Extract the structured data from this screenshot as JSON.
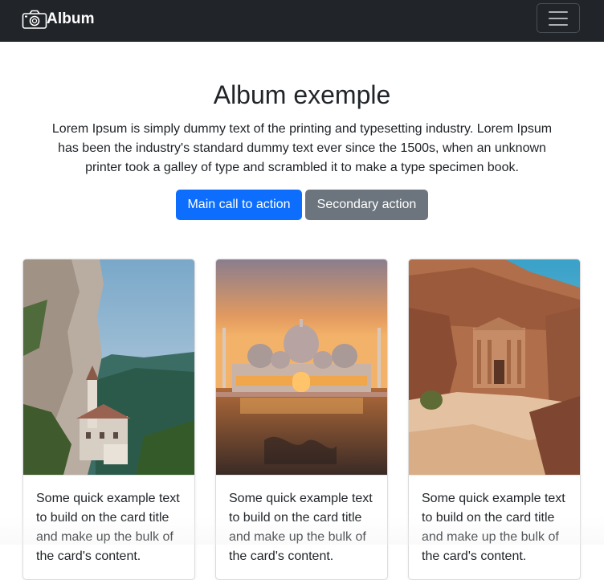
{
  "navbar": {
    "brand_icon": "camera-icon",
    "brand_text": "Album",
    "toggler_icon": "hamburger-menu-icon"
  },
  "hero": {
    "title": "Album exemple",
    "lead": "Lorem Ipsum is simply dummy text of the printing and typesetting industry. Lorem Ipsum has been the industry's standard dummy text ever since the 1500s, when an unknown printer took a galley of type and scrambled it to make a type specimen book.",
    "primary_label": "Main call to action",
    "secondary_label": "Secondary action"
  },
  "cards": [
    {
      "image": "mountain-sanctuary-photo",
      "text": "Some quick example text to build on the card title and make up the bulk of the card's content."
    },
    {
      "image": "mosque-sunset-photo",
      "text": "Some quick example text to build on the card title and make up the bulk of the card's content."
    },
    {
      "image": "petra-treasury-photo",
      "text": "Some quick example text to build on the card title and make up the bulk of the card's content."
    }
  ],
  "colors": {
    "navbar_bg": "#212529",
    "primary": "#0d6efd",
    "secondary": "#6c757d"
  }
}
